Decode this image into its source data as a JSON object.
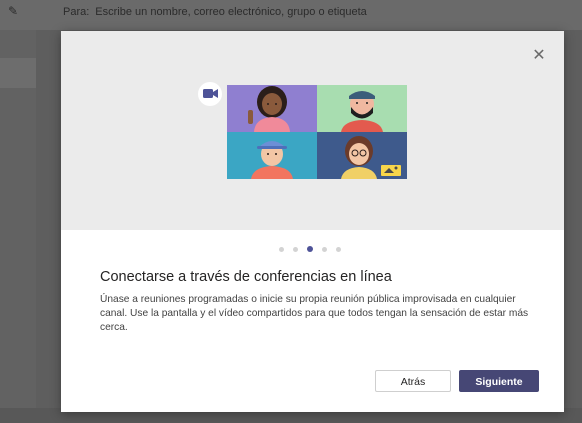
{
  "background": {
    "compose_icon": "compose-icon",
    "to_label": "Para:",
    "to_placeholder": "Escribe un nombre, correo electrónico, grupo o etiqueta"
  },
  "dialog": {
    "close_icon": "close-icon",
    "pager": {
      "total": 5,
      "active": 3
    },
    "title": "Conectarse a través de conferencias en línea",
    "body": "Únase a reuniones programadas o inicie su propia reunión pública improvisada en cualquier canal. Use la pantalla y el vídeo compartidos para que todos tengan la sensación de estar más cerca.",
    "back_label": "Atrás",
    "next_label": "Siguiente"
  },
  "colors": {
    "accent": "#464775",
    "pager_active": "#4e5398",
    "tile_purple": "#8f7fd0",
    "tile_green": "#a8ddb0",
    "tile_teal": "#3ba6c4",
    "tile_navy": "#3e5a8c"
  }
}
